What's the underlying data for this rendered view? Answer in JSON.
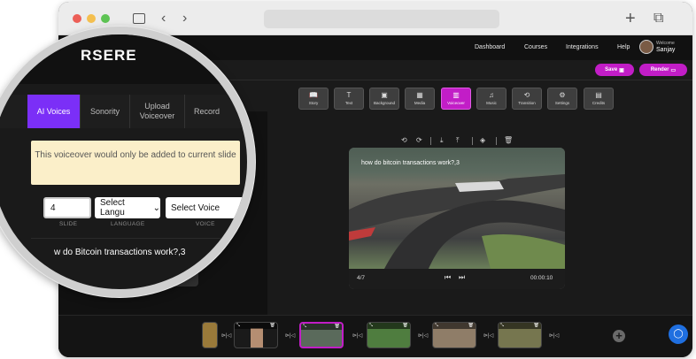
{
  "colors": {
    "accent": "#c21dc7",
    "accent_alt": "#7b2ff7",
    "notice_bg": "#fbefc9",
    "chat": "#1f6fe0"
  },
  "browser": {
    "traffic_lights": [
      "#ec5f57",
      "#f4bf4f",
      "#5ec454"
    ],
    "sidebar_icon": "sidebar-icon",
    "back_icon": "‹",
    "forward_icon": "›",
    "new_tab_icon": "+",
    "tabs_icon": "⧉"
  },
  "app": {
    "logo_text": "RSERE",
    "nav": [
      "Dashboard",
      "Courses",
      "Integrations",
      "Help"
    ],
    "user": {
      "welcome": "Welcome",
      "name": "Sanjay"
    },
    "save_label": "Save",
    "render_label": "Render"
  },
  "toolbar": [
    {
      "label": "Story",
      "icon": "📖"
    },
    {
      "label": "Text",
      "icon": "T"
    },
    {
      "label": "Background",
      "icon": "▣"
    },
    {
      "label": "Media",
      "icon": "▦"
    },
    {
      "label": "Voiceover",
      "icon": "▥"
    },
    {
      "label": "Music",
      "icon": "♫"
    },
    {
      "label": "Transition",
      "icon": "⟲"
    },
    {
      "label": "Settings",
      "icon": "⚙"
    },
    {
      "label": "Credits",
      "icon": "▤"
    }
  ],
  "preview": {
    "caption": "how do bitcoin transactions work?,3",
    "slide_counter": "4/7",
    "time": "00:00:10"
  },
  "voice_panel": {
    "tabs": [
      "AI Voices",
      "Sonority",
      "Upload Voiceover",
      "Record"
    ],
    "notice": "This voiceover would only be added to current slide",
    "slide_value": "4",
    "language_select": "Select Langu",
    "voice_select": "Select Voice",
    "captions": [
      "SLIDE",
      "LANGUAGE",
      "VOICE"
    ],
    "question": "w do Bitcoin transactions work?,3"
  }
}
